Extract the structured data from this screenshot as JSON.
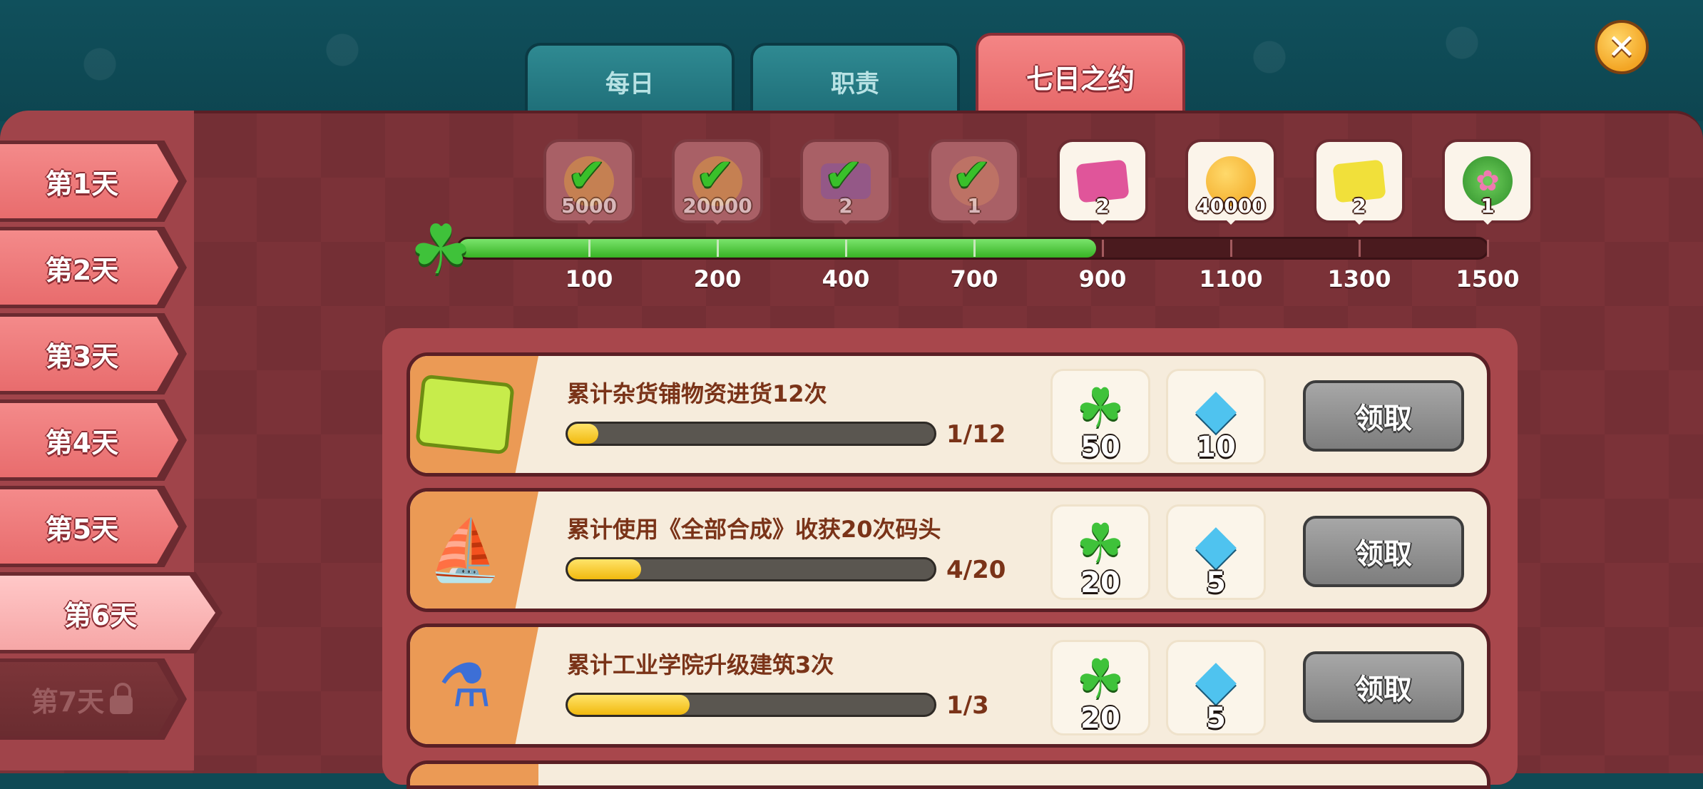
{
  "tabs": [
    {
      "label": "每日",
      "active": false
    },
    {
      "label": "职责",
      "active": false
    },
    {
      "label": "七日之约",
      "active": true
    }
  ],
  "close_icon": "close-icon",
  "days": [
    {
      "label": "第1天",
      "state": "normal"
    },
    {
      "label": "第2天",
      "state": "normal"
    },
    {
      "label": "第3天",
      "state": "normal"
    },
    {
      "label": "第4天",
      "state": "normal"
    },
    {
      "label": "第5天",
      "state": "normal"
    },
    {
      "label": "第6天",
      "state": "selected"
    },
    {
      "label": "第7天",
      "state": "locked"
    }
  ],
  "milestones": [
    {
      "threshold": "100",
      "reward_icon": "gold-coin-icon",
      "count": "5000",
      "claimed": true
    },
    {
      "threshold": "200",
      "reward_icon": "gold-coin-icon",
      "count": "20000",
      "claimed": true
    },
    {
      "threshold": "400",
      "reward_icon": "purple-ticket-icon",
      "count": "2",
      "claimed": true
    },
    {
      "threshold": "700",
      "reward_icon": "potion-icon",
      "count": "1",
      "claimed": true
    },
    {
      "threshold": "900",
      "reward_icon": "pink-ticket-icon",
      "count": "2",
      "claimed": false
    },
    {
      "threshold": "1100",
      "reward_icon": "gold-coin-icon",
      "count": "40000",
      "claimed": false
    },
    {
      "threshold": "1300",
      "reward_icon": "yellow-ticket-icon",
      "count": "2",
      "claimed": false
    },
    {
      "threshold": "1500",
      "reward_icon": "flower-fairy-icon",
      "count": "1",
      "claimed": false
    }
  ],
  "progress_bar": {
    "icon": "clover-icon",
    "fill_fraction": 0.62
  },
  "quests": [
    {
      "icon": "grocery-ticket-icon",
      "title": "累计杂货铺物资进货12次",
      "progress_text": "1/12",
      "progress_fraction": 0.083,
      "rewards": [
        {
          "icon": "clover-icon",
          "count": "50"
        },
        {
          "icon": "gem-icon",
          "count": "10"
        }
      ],
      "button_label": "领取"
    },
    {
      "icon": "ship-icon",
      "title": "累计使用《全部合成》收获20次码头",
      "progress_text": "4/20",
      "progress_fraction": 0.2,
      "rewards": [
        {
          "icon": "clover-icon",
          "count": "20"
        },
        {
          "icon": "gem-icon",
          "count": "5"
        }
      ],
      "button_label": "领取"
    },
    {
      "icon": "academy-building-icon",
      "title": "累计工业学院升级建筑3次",
      "progress_text": "1/3",
      "progress_fraction": 0.333,
      "rewards": [
        {
          "icon": "clover-icon",
          "count": "20"
        },
        {
          "icon": "gem-icon",
          "count": "5"
        }
      ],
      "button_label": "领取"
    }
  ],
  "colors": {
    "accent_tab": "#e86c6d",
    "progress_green": "#37b324",
    "quest_fill": "#f1b90e",
    "claim_button": "#8f8f8f"
  }
}
